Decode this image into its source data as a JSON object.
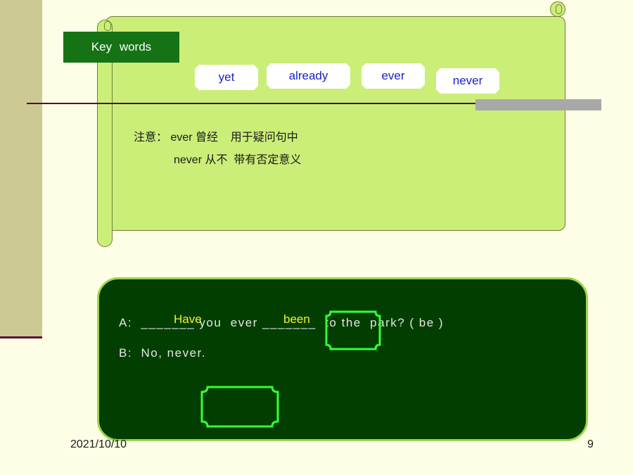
{
  "slide": {
    "key_words_label": "Key  words",
    "words": [
      "yet",
      "already",
      "ever",
      "never"
    ],
    "note": {
      "line1": "注意： ever 曾经    用于疑问句中",
      "line2": "never 从不  带有否定意义"
    },
    "dialogue": {
      "line_a": "A:  _______ you  ever _______  to the  park? ( be )",
      "fill1": "Have",
      "fill2": "been",
      "line_b": "B:  No, never."
    },
    "footer": {
      "date": "2021/10/10",
      "page": "9"
    }
  }
}
